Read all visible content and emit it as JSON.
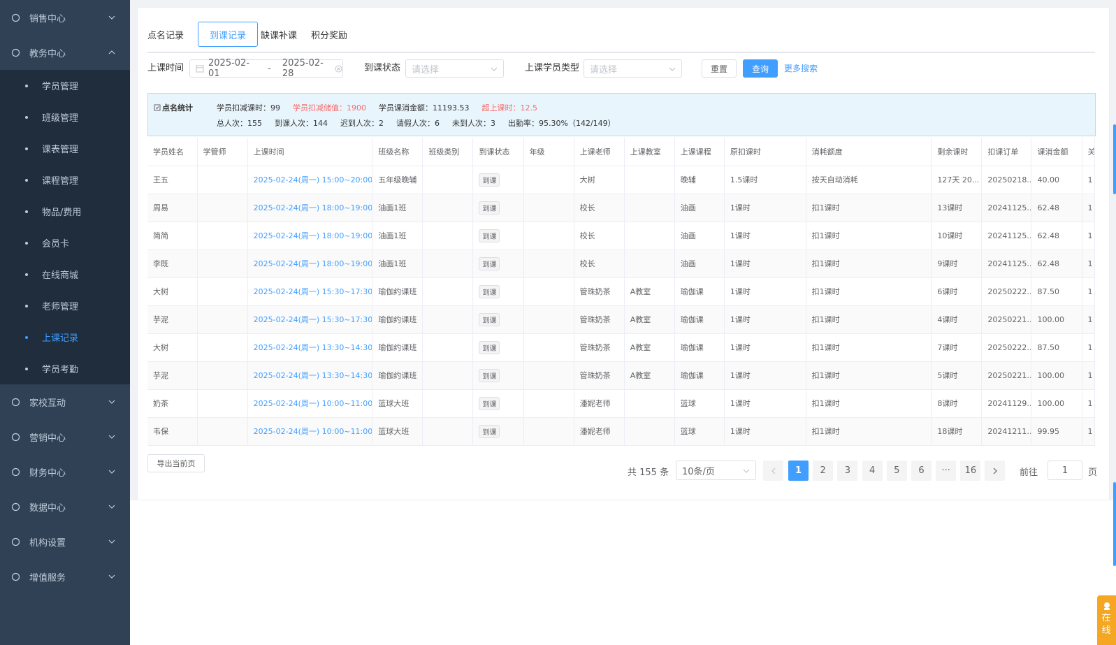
{
  "sidebar": {
    "groups": [
      {
        "label": "销售中心",
        "icon": "sales-icon"
      },
      {
        "label": "教务中心",
        "icon": "book-icon"
      },
      {
        "label": "家校互动",
        "icon": "send-icon"
      },
      {
        "label": "营销中心",
        "icon": "share-icon"
      },
      {
        "label": "财务中心",
        "icon": "finance-icon"
      },
      {
        "label": "数据中心",
        "icon": "chart-icon"
      },
      {
        "label": "机构设置",
        "icon": "gear-icon"
      },
      {
        "label": "增值服务",
        "icon": "diamond-icon"
      }
    ],
    "edu_items": [
      "学员管理",
      "班级管理",
      "课表管理",
      "课程管理",
      "物品/费用",
      "会员卡",
      "在线商城",
      "老师管理",
      "上课记录",
      "学员考勤"
    ]
  },
  "tabs": [
    "点名记录",
    "到课记录",
    "缺课补课",
    "积分奖励"
  ],
  "filters": {
    "date_label": "上课时间",
    "date_start": "2025-02-01",
    "date_sep": "-",
    "date_end": "2025-02-28",
    "status_label": "到课状态",
    "status_placeholder": "请选择",
    "type_label": "上课学员类型",
    "type_placeholder": "请选择",
    "reset": "重置",
    "search": "查询",
    "more": "更多搜索"
  },
  "stats": {
    "title": "点名统计",
    "row1": [
      {
        "text": "学员扣减课时：99",
        "red": false
      },
      {
        "text": "学员扣减储值：1900",
        "red": true
      },
      {
        "text": "学员课消金额：11193.53",
        "red": false
      },
      {
        "text": "超上课时：12.5",
        "red": true
      }
    ],
    "row2": [
      "总人次：155",
      "到课人次：144",
      "迟到人次：2",
      "请假人次：6",
      "未到人次：3",
      "出勤率：95.30%（142/149）"
    ]
  },
  "table": {
    "headers": [
      "学员姓名",
      "学管师",
      "上课时间",
      "班级名称",
      "班级类别",
      "到课状态",
      "年级",
      "上课老师",
      "上课教室",
      "上课课程",
      "原扣课时",
      "消耗额度",
      "剩余课时",
      "扣课订单",
      "课消金额",
      "关"
    ],
    "rows": [
      [
        "王五",
        "",
        "2025-02-24(周一) 15:00~20:00",
        "五年级晚辅",
        "",
        "到课",
        "",
        "大树",
        "",
        "晚辅",
        "1.5课时",
        "按天自动消耗",
        "127天 20...",
        "20250218...",
        "40.00",
        "1"
      ],
      [
        "周易",
        "",
        "2025-02-24(周一) 18:00~19:00",
        "油画1班",
        "",
        "到课",
        "",
        "校长",
        "",
        "油画",
        "1课时",
        "扣1课时",
        "13课时",
        "20241125...",
        "62.48",
        "1"
      ],
      [
        "简简",
        "",
        "2025-02-24(周一) 18:00~19:00",
        "油画1班",
        "",
        "到课",
        "",
        "校长",
        "",
        "油画",
        "1课时",
        "扣1课时",
        "10课时",
        "20241125...",
        "62.48",
        "1"
      ],
      [
        "李既",
        "",
        "2025-02-24(周一) 18:00~19:00",
        "油画1班",
        "",
        "到课",
        "",
        "校长",
        "",
        "油画",
        "1课时",
        "扣1课时",
        "9课时",
        "20241125...",
        "62.48",
        "1"
      ],
      [
        "大树",
        "",
        "2025-02-24(周一) 15:30~17:30",
        "瑜伽约课班",
        "",
        "到课",
        "",
        "管珠奶茶",
        "A教室",
        "瑜伽课",
        "1课时",
        "扣1课时",
        "6课时",
        "20250222...",
        "87.50",
        "1"
      ],
      [
        "芋泥",
        "",
        "2025-02-24(周一) 15:30~17:30",
        "瑜伽约课班",
        "",
        "到课",
        "",
        "管珠奶茶",
        "A教室",
        "瑜伽课",
        "1课时",
        "扣1课时",
        "4课时",
        "20250221...",
        "100.00",
        "1"
      ],
      [
        "大树",
        "",
        "2025-02-24(周一) 13:30~14:30",
        "瑜伽约课班",
        "",
        "到课",
        "",
        "管珠奶茶",
        "A教室",
        "瑜伽课",
        "1课时",
        "扣1课时",
        "7课时",
        "20250222...",
        "87.50",
        "1"
      ],
      [
        "芋泥",
        "",
        "2025-02-24(周一) 13:30~14:30",
        "瑜伽约课班",
        "",
        "到课",
        "",
        "管珠奶茶",
        "A教室",
        "瑜伽课",
        "1课时",
        "扣1课时",
        "5课时",
        "20250221...",
        "100.00",
        "1"
      ],
      [
        "奶茶",
        "",
        "2025-02-24(周一) 10:00~11:00",
        "篮球大班",
        "",
        "到课",
        "",
        "潘妮老师",
        "",
        "篮球",
        "1课时",
        "扣1课时",
        "8课时",
        "20241129...",
        "100.00",
        "1"
      ],
      [
        "韦保",
        "",
        "2025-02-24(周一) 10:00~11:00",
        "篮球大班",
        "",
        "到课",
        "",
        "潘妮老师",
        "",
        "篮球",
        "1课时",
        "扣1课时",
        "18课时",
        "20241211...",
        "99.95",
        "1"
      ]
    ]
  },
  "export_label": "导出当前页",
  "pagination": {
    "total": "共 155 条",
    "page_size": "10条/页",
    "pages": [
      "1",
      "2",
      "3",
      "4",
      "5",
      "6",
      "···",
      "16"
    ],
    "current": "1",
    "goto_label": "前往",
    "goto_value": "1",
    "goto_suffix": "页"
  },
  "online_label": "在线",
  "colors": {
    "sidebar_bg": "#304156",
    "submenu_bg": "#1f2d3d",
    "accent": "#409eff",
    "danger": "#f56c6c"
  }
}
